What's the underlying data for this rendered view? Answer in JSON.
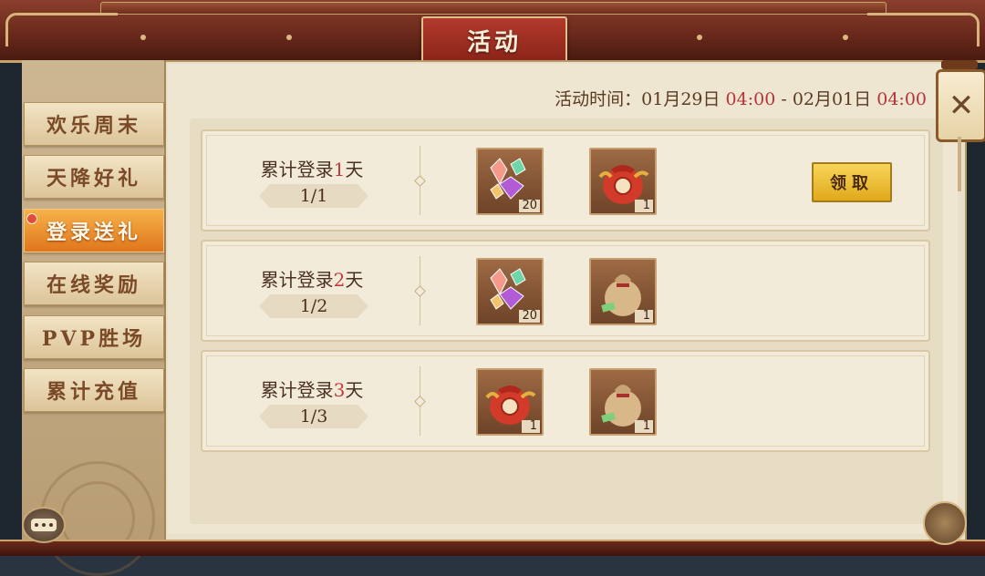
{
  "header": {
    "title": "活动"
  },
  "time": {
    "label": "活动时间：",
    "start_date": "01月29日",
    "start_time": "04:00",
    "separator": "-",
    "end_date": "02月01日",
    "end_time": "04:00"
  },
  "sidebar": {
    "tabs": [
      {
        "label": "欢乐周末",
        "active": false
      },
      {
        "label": "天降好礼",
        "active": false
      },
      {
        "label": "登录送礼",
        "active": true,
        "badge": true
      },
      {
        "label": "在线奖励",
        "active": false
      },
      {
        "label": "PVP胜场",
        "active": false
      },
      {
        "label": "累计充值",
        "active": false
      }
    ]
  },
  "rows": [
    {
      "title_prefix": "累计登录",
      "day": "1",
      "title_suffix": "天",
      "progress": "1/1",
      "rewards": [
        {
          "icon": "gem-pile-icon",
          "count": "20"
        },
        {
          "icon": "red-lucky-bag-icon",
          "count": "1"
        }
      ],
      "claim_label": "领取"
    },
    {
      "title_prefix": "累计登录",
      "day": "2",
      "title_suffix": "天",
      "progress": "1/2",
      "rewards": [
        {
          "icon": "gem-pile-icon",
          "count": "20"
        },
        {
          "icon": "tan-money-bag-icon",
          "count": "1"
        }
      ]
    },
    {
      "title_prefix": "累计登录",
      "day": "3",
      "title_suffix": "天",
      "progress": "1/3",
      "rewards": [
        {
          "icon": "red-lucky-bag-icon",
          "count": "1"
        },
        {
          "icon": "tan-money-bag-icon",
          "count": "1"
        }
      ]
    }
  ],
  "colors": {
    "accent_red": "#b3343a",
    "tab_active": "#e0761c",
    "claim_button": "#f0c030"
  }
}
